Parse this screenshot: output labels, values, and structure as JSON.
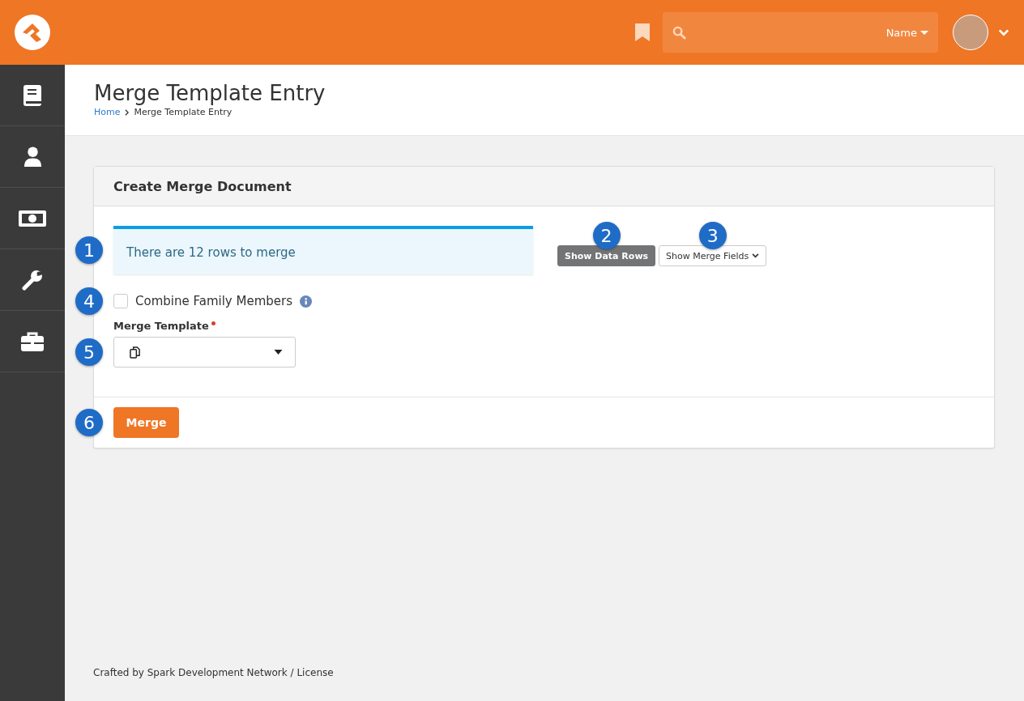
{
  "header": {
    "search": {
      "filter": "Name"
    }
  },
  "sidebar": {
    "items": [
      {
        "kind": "book"
      },
      {
        "kind": "person"
      },
      {
        "kind": "money"
      },
      {
        "kind": "wrench"
      },
      {
        "kind": "briefcase"
      }
    ]
  },
  "page": {
    "title": "Merge Template Entry",
    "breadcrumb": [
      {
        "label": "Home",
        "kind": "link"
      },
      {
        "label": "Merge Template Entry",
        "kind": "current"
      }
    ]
  },
  "panel": {
    "title": "Create Merge Document",
    "alert": {
      "text": "There are 12 rows to merge",
      "callout": "1"
    },
    "buttons": [
      {
        "label": "Show Data Rows",
        "kind": "dark",
        "callout": "2"
      },
      {
        "label": "Show Merge Fields",
        "kind": "dropdown",
        "callout": "3"
      }
    ],
    "checkbox": {
      "label": "Combine Family Members",
      "checked": false,
      "callout": "4"
    },
    "select": {
      "label": "Merge Template",
      "required": true,
      "callout": "5"
    },
    "action": {
      "label": "Merge",
      "callout": "6"
    }
  },
  "footer": {
    "text": "Crafted by Spark Development Network / License"
  }
}
